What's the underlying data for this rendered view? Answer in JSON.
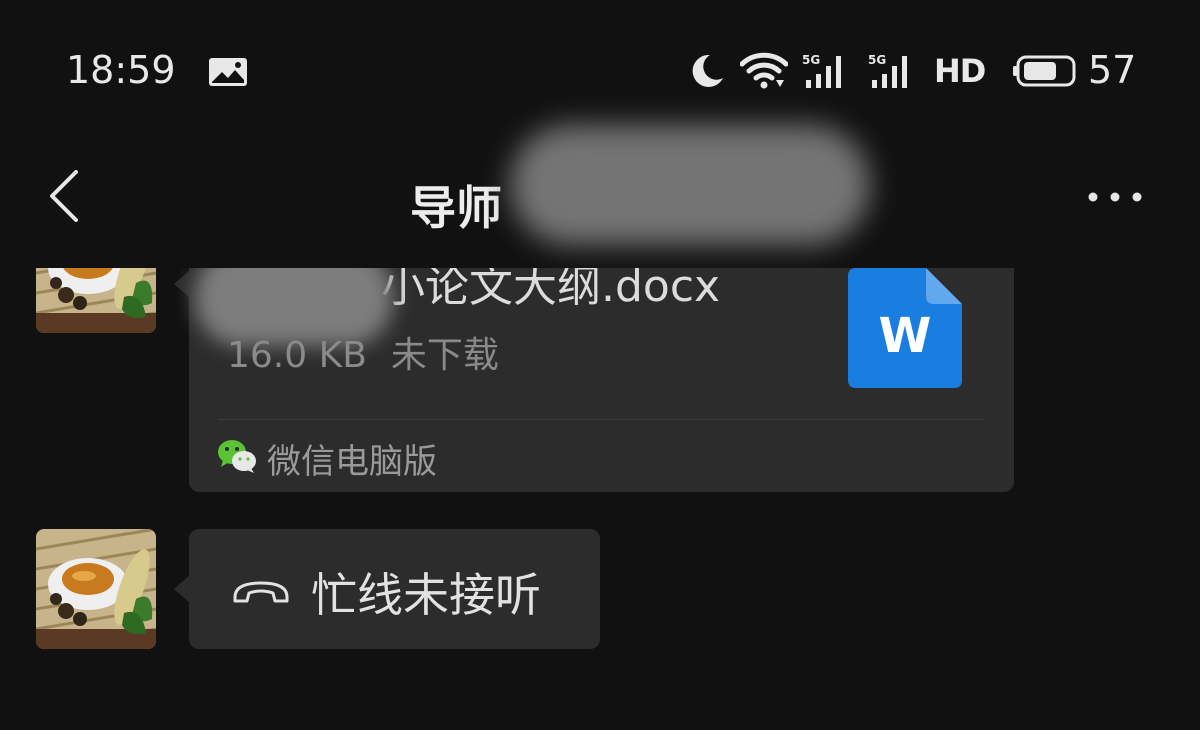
{
  "status_bar": {
    "time": "18:59",
    "network_type": "5G",
    "hd_label": "HD",
    "battery_level": "57"
  },
  "header": {
    "title": "导师"
  },
  "messages": [
    {
      "type": "file",
      "file_name": "小论文大纲.docx",
      "file_size": "16.0 KB",
      "download_status": "未下载",
      "source": "微信电脑版",
      "file_icon_letter": "W",
      "file_icon_color": "#1a7ee0"
    },
    {
      "type": "call",
      "text": "忙线未接听"
    }
  ],
  "colors": {
    "background": "#111111",
    "bubble": "#2c2c2c",
    "wechat_green": "#5bc236"
  }
}
